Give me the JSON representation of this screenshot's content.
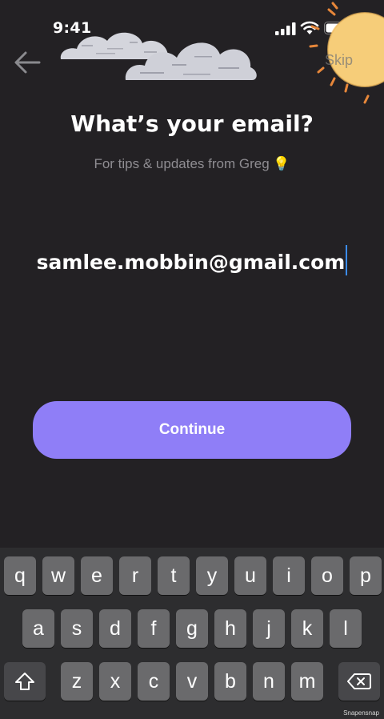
{
  "status_bar": {
    "time": "9:41"
  },
  "nav": {
    "skip_label": "Skip"
  },
  "header": {
    "title": "What’s your email?",
    "subtitle": "For tips & updates from Greg 💡"
  },
  "form": {
    "email_value": "samlee.mobbin@gmail.com"
  },
  "actions": {
    "continue_label": "Continue"
  },
  "keyboard": {
    "row1": [
      "q",
      "w",
      "e",
      "r",
      "t",
      "y",
      "u",
      "i",
      "o",
      "p"
    ],
    "row2": [
      "a",
      "s",
      "d",
      "f",
      "g",
      "h",
      "j",
      "k",
      "l"
    ],
    "row3": [
      "z",
      "x",
      "c",
      "v",
      "b",
      "n",
      "m"
    ]
  },
  "watermark": "Snapensnap",
  "colors": {
    "background": "#232124",
    "accent": "#8f7ef7",
    "caret": "#3b8cf7"
  }
}
